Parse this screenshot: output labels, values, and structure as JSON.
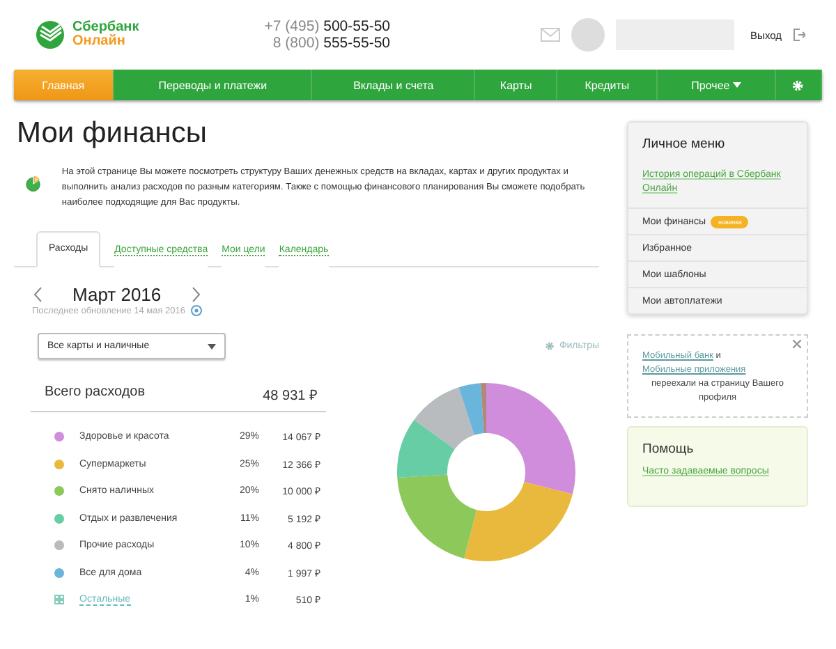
{
  "header": {
    "logo": {
      "line1": "Сбербанк",
      "line2": "Онлайн"
    },
    "phones": [
      {
        "code": "+7 (495)",
        "number": "500-55-50"
      },
      {
        "code": "8 (800)",
        "number": "555-55-50"
      }
    ],
    "logout": "Выход"
  },
  "nav": [
    {
      "label": "Главная",
      "selected": true
    },
    {
      "label": "Переводы и платежи",
      "selected": false
    },
    {
      "label": "Вклады и счета",
      "selected": false
    },
    {
      "label": "Карты",
      "selected": false
    },
    {
      "label": "Кредиты",
      "selected": false
    },
    {
      "label": "Прочее",
      "selected": false
    }
  ],
  "page_title": "Мои финансы",
  "intro": "На этой странице Вы можете посмотреть структуру Ваших денежных средств на вкладах, картах и других продуктах и выполнить анализ расходов по разным категориям. Также с помощью финансового планирования Вы сможете подобрать наиболее подходящие для Вас продукты.",
  "tabs": [
    {
      "label": "Расходы",
      "selected": true
    },
    {
      "label": "Доступные средства",
      "selected": false
    },
    {
      "label": "Мои цели",
      "selected": false
    },
    {
      "label": "Календарь",
      "selected": false
    }
  ],
  "period": {
    "month": "Март 2016",
    "updated": "Последнее обновление 14 мая 2016"
  },
  "card_select": {
    "value": "Все карты и наличные"
  },
  "filters": "Фильтры",
  "total": {
    "label": "Всего расходов",
    "amount": "48 931 ₽"
  },
  "categories": [
    {
      "name": "Здоровье и красота",
      "percent": "29%",
      "amount": "14 067 ₽",
      "color": "#d08ddc",
      "kind": "dot"
    },
    {
      "name": "Супермаркеты",
      "percent": "25%",
      "amount": "12 366 ₽",
      "color": "#e8b93c",
      "kind": "dot"
    },
    {
      "name": "Снято наличных",
      "percent": "20%",
      "amount": "10 000 ₽",
      "color": "#8cc85a",
      "kind": "dot"
    },
    {
      "name": "Отдых и развлечения",
      "percent": "11%",
      "amount": "5 192 ₽",
      "color": "#66cda5",
      "kind": "dot"
    },
    {
      "name": "Прочие расходы",
      "percent": "10%",
      "amount": "4 800 ₽",
      "color": "#b8bcbe",
      "kind": "dot"
    },
    {
      "name": "Все для дома",
      "percent": "4%",
      "amount": "1 997 ₽",
      "color": "#6ab5db",
      "kind": "dot"
    },
    {
      "name": "Остальные",
      "percent": "1%",
      "amount": "510 ₽",
      "color": "#b08a78",
      "kind": "link"
    }
  ],
  "personal_menu": {
    "title": "Личное меню",
    "history_link": "История операций в Сбербанк Онлайн",
    "items": [
      {
        "label": "Мои финансы",
        "badge": "новинка"
      },
      {
        "label": "Избранное"
      },
      {
        "label": "Мои шаблоны"
      },
      {
        "label": "Мои автоплатежи"
      }
    ]
  },
  "notice": {
    "link1": "Мобильный банк",
    "and": "и",
    "link2": "Мобильные приложения",
    "text": "переехали на страницу Вашего профиля"
  },
  "help": {
    "title": "Помощь",
    "link": "Часто задаваемые вопросы"
  }
}
